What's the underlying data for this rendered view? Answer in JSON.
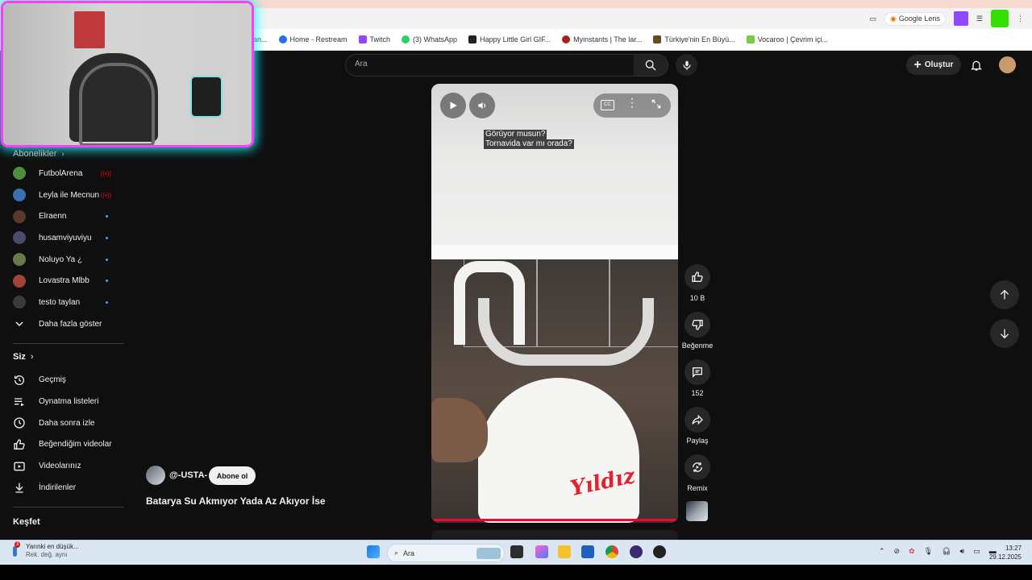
{
  "browser": {
    "bookmarks": [
      {
        "label": "an...",
        "color": "#888888"
      },
      {
        "label": "Home - Restream",
        "color": "#2a6cf0"
      },
      {
        "label": "Twitch",
        "color": "#9146ff"
      },
      {
        "label": "(3) WhatsApp",
        "color": "#25d366"
      },
      {
        "label": "Happy Little Girl GIF...",
        "color": "#222222"
      },
      {
        "label": "Myinstants | The lar...",
        "color": "#b01b1b"
      },
      {
        "label": "Türkiye'nin En Büyü...",
        "color": "#6b4a1f"
      },
      {
        "label": "Vocaroo | Çevrim içi...",
        "color": "#7ac943"
      }
    ],
    "google_chip": "Google Lens"
  },
  "topbar": {
    "search_placeholder": "Ara",
    "create_label": "Oluştur"
  },
  "sidebar": {
    "subscriptions_title": "Abonelikler",
    "subscriptions": [
      {
        "name": "FutbolArena",
        "color": "#4c8f3d",
        "status": "live"
      },
      {
        "name": "Leyla ile Mecnun",
        "color": "#3a6fb0",
        "status": "live"
      },
      {
        "name": "Elraenn",
        "color": "#5a3a2e",
        "status": "new"
      },
      {
        "name": "husamviyuviyu",
        "color": "#4a4a6a",
        "status": "new"
      },
      {
        "name": "Noluyo Ya ¿",
        "color": "#6a7a4a",
        "status": "new"
      },
      {
        "name": "Lovastra Mlbb",
        "color": "#a0443a",
        "status": "new"
      },
      {
        "name": "testo taylan",
        "color": "#3a3a3a",
        "status": "new"
      }
    ],
    "show_more": "Daha fazla göster",
    "you_title": "Siz",
    "you_items": [
      {
        "label": "Geçmiş",
        "icon": "history-icon"
      },
      {
        "label": "Oynatma listeleri",
        "icon": "playlists-icon"
      },
      {
        "label": "Daha sonra izle",
        "icon": "watch-later-icon"
      },
      {
        "label": "Beğendiğim videolar",
        "icon": "liked-videos-icon"
      },
      {
        "label": "Videolarınız",
        "icon": "your-videos-icon"
      },
      {
        "label": "İndirilenler",
        "icon": "downloads-icon"
      }
    ],
    "explore_title": "Keşfet"
  },
  "video": {
    "caption_lines": [
      "Görüyor musun?",
      "Tornavida var mı orada?"
    ],
    "bucket_text": "Yıldız",
    "channel": "@-USTA-",
    "subscribe_label": "Abone ol",
    "title": "Batarya Su Akmıyor Yada Az Akıyor İse",
    "progress_fraction": 1.0
  },
  "actions": {
    "like_count": "10 B",
    "dislike_label": "Beğenme",
    "comment_count": "152",
    "share_label": "Paylaş",
    "remix_label": "Remix"
  },
  "taskbar": {
    "weather_line1": "Yarınki en düşük...",
    "weather_line2": "Rek. değ. aynı",
    "weather_badge": "3",
    "search_label": "Ara",
    "time": "13:27",
    "date": "29.12.2025"
  }
}
